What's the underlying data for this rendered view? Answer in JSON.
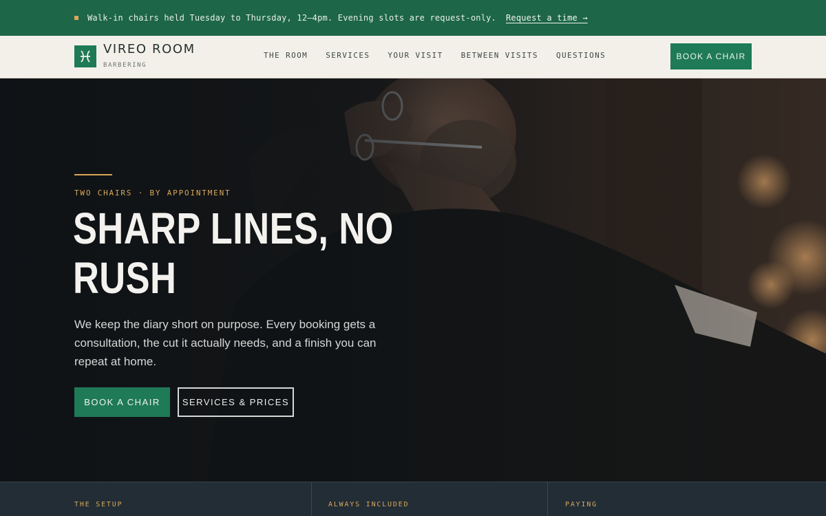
{
  "announcement": {
    "text": "Walk-in chairs held Tuesday to Thursday, 12–4pm. Evening slots are request-only.",
    "link_label": "Request a time →"
  },
  "header": {
    "brand_name": "VIREO ROOM",
    "brand_sub": "BARBERING",
    "nav": [
      "THE ROOM",
      "SERVICES",
      "YOUR VISIT",
      "BETWEEN VISITS",
      "QUESTIONS"
    ],
    "cta_label": "BOOK A CHAIR"
  },
  "hero": {
    "eyebrow": "TWO CHAIRS · BY APPOINTMENT",
    "title_line1": "SHARP LINES, NO",
    "title_line2": "RUSH",
    "body": "We keep the diary short on purpose. Every booking gets a consultation, the cut it actually needs, and a finish you can repeat at home.",
    "primary_button": "BOOK A CHAIR",
    "secondary_button": "SERVICES & PRICES"
  },
  "strip": {
    "columns": [
      "THE SETUP",
      "ALWAYS INCLUDED",
      "PAYING"
    ]
  },
  "colors": {
    "brand_green": "#1f7a57",
    "announce_green": "#1d6647",
    "accent_gold": "#d9a65a",
    "header_bg": "#f3f0ea",
    "hero_bg": "#121619",
    "strip_bg": "#222d36"
  },
  "icons": {
    "logo": "scissors-icon"
  }
}
